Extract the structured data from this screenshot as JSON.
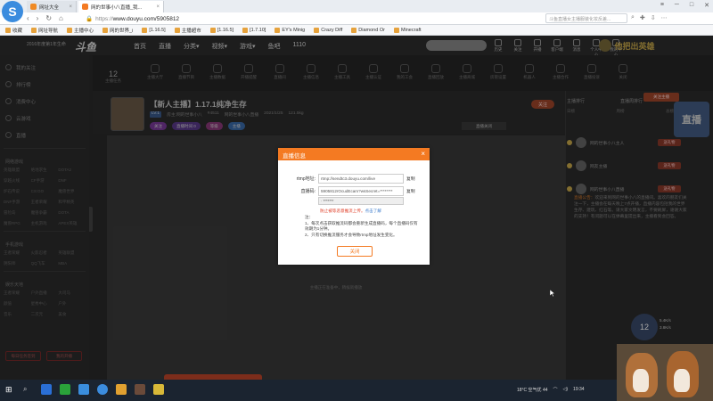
{
  "browser": {
    "tabs": [
      {
        "label": "网址大全",
        "active": false
      },
      {
        "label": "网的世事小八直播_我...",
        "active": true
      }
    ],
    "url_prefix": "https://",
    "url": "www.douyu.com/5905812",
    "search_placeholder": "斗鱼直播女主播服装化妆反差...",
    "bookmarks": [
      "收藏",
      "网址导航",
      "主播中心",
      "网的世界_i",
      "[1.16.5]",
      "主播超市",
      "[1.16.5]",
      "[1.7.10]",
      "EY's Minig",
      "Crazy Diff",
      "Diamond Or",
      "Minecraft"
    ]
  },
  "site": {
    "brand_text": "2016年度第1年生命",
    "brand_logo": "斗鱼",
    "nav": [
      {
        "label": "首页",
        "active": false
      },
      {
        "label": "直播",
        "active": false
      },
      {
        "label": "分类▾",
        "active": false
      },
      {
        "label": "视频▾",
        "active": false
      },
      {
        "label": "游戏▾",
        "active": false
      },
      {
        "label": "鱼吧",
        "active": false
      },
      {
        "label": "1110",
        "active": false
      }
    ],
    "header_icons": [
      "历史",
      "关注",
      "开播",
      "客户端",
      "消息",
      "个人中心",
      "我的中心"
    ],
    "banner_text": "他把出英雄"
  },
  "sidebar": {
    "items": [
      "我的关注",
      "排行榜",
      "消费中心",
      "云游戏",
      "直播"
    ],
    "sections": [
      {
        "title": "网络游戏",
        "items": [
          "英雄联盟",
          "绝地求生",
          "DOTA2",
          "穿越火线",
          "CF手游",
          "DNF",
          "炉石传说",
          "CS:GO",
          "魔兽世界",
          "DNF手游",
          "王者荣耀",
          "和平精英",
          "冒险岛",
          "魔兽争霸",
          "DOTA",
          "魔兽RPG",
          "主机游戏",
          "APEX英雄"
        ]
      },
      {
        "title": "手机游戏",
        "items": [
          "王者荣耀",
          "火影忍者",
          "英雄联盟",
          "阴阳师",
          "QQ飞车",
          "MBA"
        ]
      },
      {
        "title": "娱乐天地",
        "items": [
          "王者荣耀",
          "户外直播",
          "大司马",
          "颜值",
          "星秀中心",
          "户外",
          "音乐",
          "二次元",
          "美食"
        ]
      }
    ],
    "bottom_buttons": [
      "每日任务签到",
      "我的开播"
    ]
  },
  "category_bar": {
    "count": "12",
    "count_label": "主播任务",
    "items": [
      "主播大厅",
      "直播节目",
      "主播数据",
      "开播提醒",
      "直播间",
      "主播信息",
      "主播工具",
      "主播认证",
      "我的工会",
      "直播回放",
      "主播商城",
      "房管设置",
      "机器人",
      "主播合作",
      "直播投诉",
      "关闭"
    ]
  },
  "room": {
    "title": "【新人主播】1.17.1纯净生存",
    "meta": [
      "LV.1",
      "房主:网的世事小八",
      "#4511",
      "网的世事小八直播",
      "2021/1/25",
      "121.5kg"
    ],
    "tags": [
      "关注",
      "直播时间 0",
      "等级",
      "主播"
    ],
    "like": "关注",
    "report": "直播关闭"
  },
  "video": {
    "hint": "主播正在准备中，稍候就播放"
  },
  "right_panel": {
    "tabs": [
      "主播排行",
      "直播周排行"
    ],
    "badge": "关注主播",
    "sub": [
      "日榜",
      "周榜",
      "总榜"
    ],
    "mascot": "直播",
    "ranking": [
      {
        "name": "网的世事小八主人",
        "button": "送礼物"
      },
      {
        "name": "网友主播",
        "button": "送礼物"
      },
      {
        "name": "网的世事小八直播",
        "button": "送礼物"
      }
    ],
    "notice_label": "直播公告：",
    "notice": "欢迎来到网的世事小八的直播间。喜欢的朋友们关注一下，主播会在每天晚上7点开播，直播内容包括我的世界生存、建筑、红石等。请大家文明发言，不要刷屏，谢谢大家的支持！有问题可以在弹幕里提出来，主播看到会回答。"
  },
  "pip": {
    "dial": "12",
    "stats": [
      "5.4K/s",
      "3.8K/s"
    ]
  },
  "modal": {
    "title": "直播信息",
    "close": "×",
    "rtmp_label": "rtmp地址:",
    "rtmp_value": "rtmp://sendtc3.douyu.com/live",
    "code_label": "直播码:",
    "code_value": "5905812rOcudEcam?wsSecret=********",
    "code_select": "· *******",
    "copy_label": "复制",
    "warning": "防止被等恶意推流上传。",
    "warning_link": "点击了解",
    "notes_title": "注：",
    "notes": [
      "1、每次点击获取推流码都会重新生成直播码，每个直播码仅有效期为1分钟。",
      "2、只有切换推流服务才会导致rtmp地址发生变化。"
    ],
    "button": "关闭"
  },
  "taskbar": {
    "weather": "18°C 空气优 44",
    "time": "19:34"
  },
  "colors": {
    "accent": "#f47a22",
    "page_bg": "#2a2a2a",
    "taskbar": "#1b2430"
  }
}
